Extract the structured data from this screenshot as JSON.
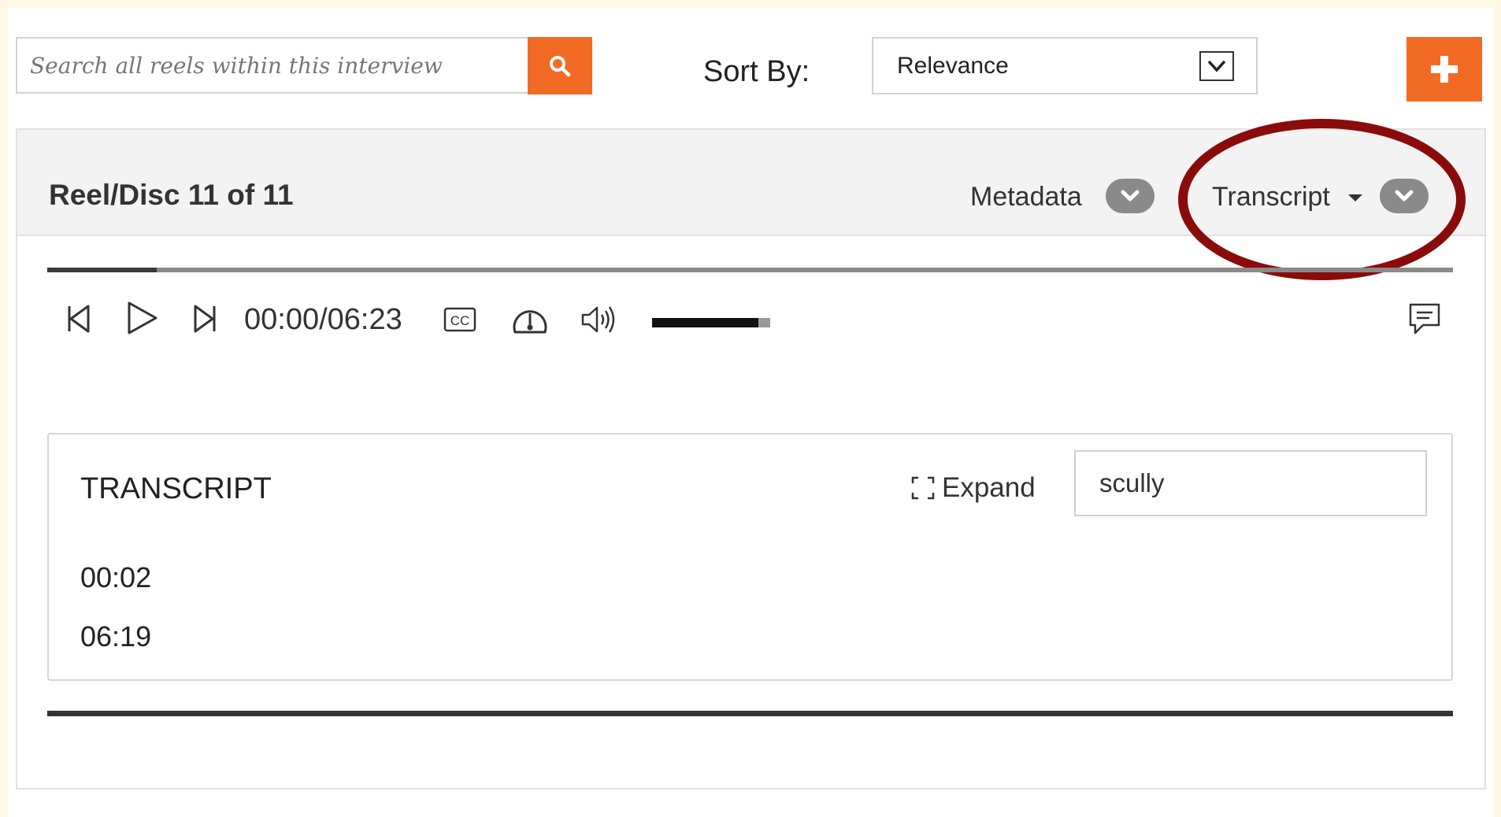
{
  "toolbar": {
    "search_placeholder": "Search all reels within this interview",
    "sort_label": "Sort By:",
    "sort_value": "Relevance",
    "accent_color": "#f26b24"
  },
  "reel": {
    "title": "Reel/Disc 11 of 11",
    "metadata_label": "Metadata",
    "transcript_label": "Transcript",
    "highlight_color": "#8b0b0b"
  },
  "player": {
    "time": "00:00/06:23",
    "progress_fraction": 0.078,
    "volume_fraction": 0.9
  },
  "transcript": {
    "heading": "TRANSCRIPT",
    "expand_label": "Expand",
    "search_value": "scully",
    "timestamps": [
      "00:02",
      "06:19"
    ]
  }
}
